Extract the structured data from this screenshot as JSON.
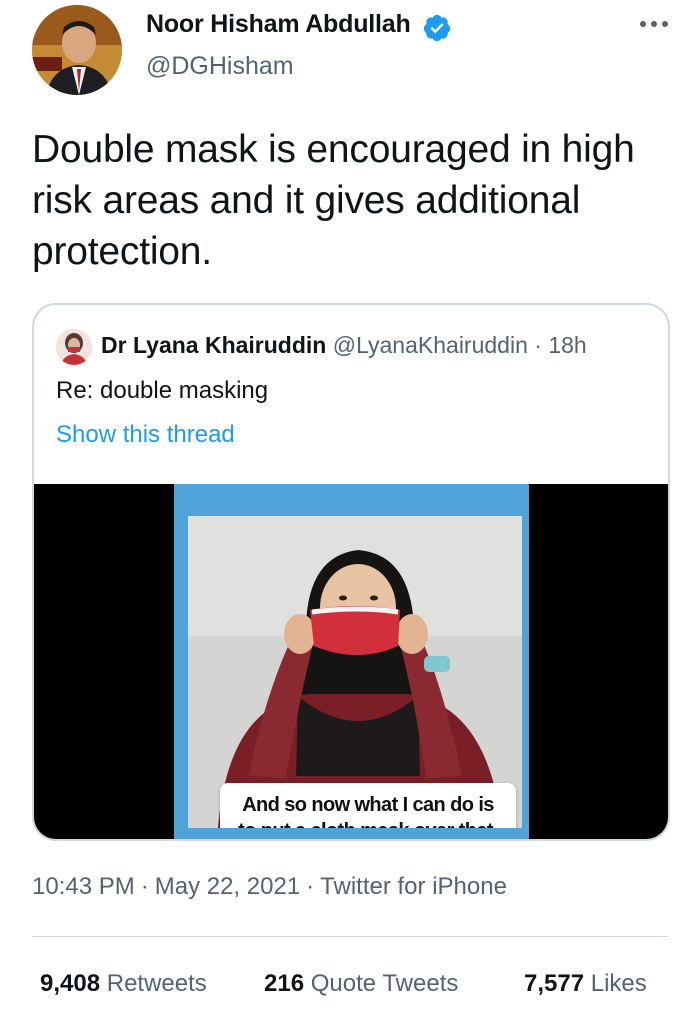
{
  "author": {
    "name": "Noor Hisham Abdullah",
    "handle": "@DGHisham",
    "verified": true
  },
  "tweet": {
    "text": "Double mask is encouraged in high risk areas and it gives additional protection."
  },
  "quoted": {
    "name": "Dr Lyana Khairuddin",
    "handle": "@LyanaKhairuddin",
    "separator": "·",
    "time": "18h",
    "text": "Re: double masking",
    "thread_link": "Show this thread",
    "video_caption_line1": "And so now what I can do is",
    "video_caption_line2": "to put a cloth mask over that."
  },
  "meta": {
    "time": "10:43 PM",
    "separator": "·",
    "date": "May 22, 2021",
    "source": "Twitter for iPhone"
  },
  "stats": {
    "retweets_count": "9,408",
    "retweets_label": "Retweets",
    "quotes_count": "216",
    "quotes_label": "Quote Tweets",
    "likes_count": "7,577",
    "likes_label": "Likes"
  },
  "colors": {
    "accent": "#1d9bf0",
    "text_primary": "#0f1419",
    "text_secondary": "#536471",
    "border": "#cfd9de",
    "video_background": "#4fa3d9"
  },
  "icons": {
    "verified": "verified-badge-icon",
    "more": "more-options-icon"
  }
}
